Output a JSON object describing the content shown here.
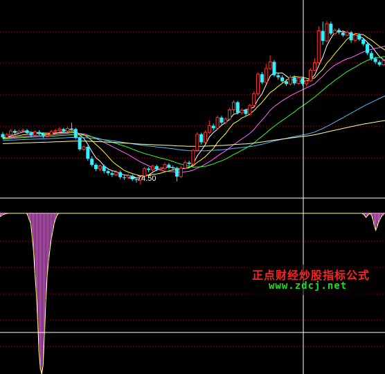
{
  "chart_data": [
    {
      "type": "candlestick",
      "panel": "price",
      "annotation_low": "74.50",
      "candles": [
        [
          98.6,
          97.0,
          99.6,
          96.2
        ],
        [
          97.0,
          98.4,
          99.1,
          96.6
        ],
        [
          98.4,
          100.1,
          101.0,
          97.8
        ],
        [
          100.1,
          99.2,
          100.9,
          98.3
        ],
        [
          99.2,
          100.0,
          100.7,
          98.6
        ],
        [
          100.0,
          100.4,
          101.3,
          99.3
        ],
        [
          100.4,
          99.1,
          101.0,
          98.4
        ],
        [
          99.1,
          98.0,
          100.0,
          97.2
        ],
        [
          98.0,
          99.6,
          100.4,
          97.4
        ],
        [
          99.6,
          98.6,
          100.5,
          98.0
        ],
        [
          98.6,
          97.7,
          99.4,
          96.8
        ],
        [
          97.7,
          98.2,
          99.1,
          97.0
        ],
        [
          98.2,
          99.8,
          100.6,
          97.6
        ],
        [
          99.8,
          100.2,
          101.2,
          99.0
        ],
        [
          100.2,
          101.0,
          102.0,
          99.5
        ],
        [
          101.0,
          100.1,
          101.6,
          99.1
        ],
        [
          100.1,
          101.3,
          102.2,
          99.6
        ],
        [
          101.3,
          101.0,
          104.0,
          100.2
        ],
        [
          101.0,
          96.8,
          101.6,
          96.0
        ],
        [
          96.8,
          91.3,
          97.5,
          90.6
        ],
        [
          91.3,
          92.5,
          93.3,
          90.4
        ],
        [
          92.5,
          86.8,
          93.0,
          85.8
        ],
        [
          86.8,
          83.9,
          88.0,
          83.1
        ],
        [
          83.9,
          81.9,
          84.6,
          81.0
        ],
        [
          81.9,
          83.4,
          84.0,
          80.9
        ],
        [
          83.4,
          80.9,
          84.1,
          79.8
        ],
        [
          80.9,
          79.9,
          81.7,
          78.8
        ],
        [
          79.9,
          79.1,
          80.8,
          78.1
        ],
        [
          79.1,
          80.4,
          81.2,
          78.5
        ],
        [
          80.4,
          78.0,
          81.1,
          77.0
        ],
        [
          78.0,
          77.9,
          78.8,
          76.8
        ],
        [
          77.9,
          78.7,
          79.6,
          77.1
        ],
        [
          78.7,
          77.0,
          79.3,
          76.1
        ],
        [
          77.0,
          76.6,
          77.8,
          75.4
        ],
        [
          76.6,
          78.3,
          78.9,
          74.5
        ],
        [
          78.3,
          82.1,
          82.9,
          77.6
        ],
        [
          82.1,
          81.5,
          82.8,
          80.4
        ],
        [
          81.5,
          83.3,
          84.0,
          80.7
        ],
        [
          83.3,
          81.8,
          84.0,
          80.9
        ],
        [
          81.8,
          82.2,
          83.0,
          81.1
        ],
        [
          82.2,
          84.0,
          85.1,
          81.6
        ],
        [
          84.0,
          82.7,
          84.8,
          81.8
        ],
        [
          82.7,
          82.4,
          83.6,
          81.3
        ],
        [
          82.4,
          78.3,
          83.0,
          76.0
        ],
        [
          78.3,
          82.3,
          83.5,
          77.6
        ],
        [
          82.3,
          85.0,
          86.1,
          81.7
        ],
        [
          85.0,
          84.3,
          85.9,
          83.2
        ],
        [
          84.3,
          90.8,
          91.5,
          83.6
        ],
        [
          90.8,
          98.5,
          99.5,
          90.1
        ],
        [
          98.5,
          94.7,
          99.3,
          93.6
        ],
        [
          94.7,
          99.4,
          100.3,
          93.8
        ],
        [
          99.4,
          102.6,
          105.1,
          98.8
        ],
        [
          102.6,
          101.4,
          103.6,
          100.3
        ],
        [
          101.4,
          106.5,
          107.5,
          100.9
        ],
        [
          106.5,
          104.1,
          107.3,
          103.2
        ],
        [
          104.1,
          105.8,
          106.6,
          103.2
        ],
        [
          105.8,
          110.2,
          111.2,
          105.0
        ],
        [
          110.2,
          113.8,
          114.8,
          108.1
        ],
        [
          113.8,
          108.8,
          114.4,
          107.9
        ],
        [
          108.8,
          110.0,
          110.9,
          107.8
        ],
        [
          110.0,
          108.2,
          110.8,
          107.2
        ],
        [
          108.2,
          112.3,
          113.1,
          107.4
        ],
        [
          112.3,
          117.9,
          119.0,
          111.6
        ],
        [
          117.9,
          127.2,
          128.0,
          116.9
        ],
        [
          127.2,
          123.3,
          128.2,
          122.5
        ],
        [
          123.3,
          129.9,
          132.1,
          122.5
        ],
        [
          129.9,
          133.1,
          136.2,
          129.2
        ],
        [
          133.1,
          126.7,
          134.0,
          126.0
        ],
        [
          126.7,
          125.7,
          127.6,
          124.6
        ],
        [
          125.7,
          123.8,
          126.7,
          122.9
        ],
        [
          123.8,
          122.5,
          124.8,
          121.6
        ],
        [
          122.5,
          125.7,
          126.8,
          121.8
        ],
        [
          125.7,
          122.8,
          126.7,
          121.9
        ],
        [
          122.8,
          125.3,
          126.2,
          122.1
        ],
        [
          125.3,
          122.6,
          125.9,
          121.7
        ],
        [
          122.6,
          124.0,
          124.6,
          121.4
        ],
        [
          124.0,
          129.1,
          130.1,
          123.6
        ],
        [
          129.1,
          132.7,
          134.8,
          128.6
        ],
        [
          132.7,
          147.9,
          150.0,
          132.2
        ],
        [
          147.9,
          143.1,
          152.3,
          141.2
        ],
        [
          143.1,
          151.3,
          152.6,
          142.5
        ],
        [
          151.3,
          146.6,
          152.4,
          145.8
        ],
        [
          146.6,
          148.3,
          149.1,
          145.9
        ],
        [
          148.3,
          147.2,
          149.2,
          146.2
        ],
        [
          147.2,
          145.8,
          147.9,
          145.0
        ],
        [
          145.8,
          147.2,
          148.0,
          145.3
        ],
        [
          147.2,
          143.4,
          147.9,
          142.2
        ],
        [
          143.4,
          145.9,
          146.9,
          142.4
        ],
        [
          145.9,
          143.8,
          146.9,
          143.1
        ],
        [
          143.8,
          141.6,
          144.5,
          140.7
        ],
        [
          141.6,
          137.3,
          142.2,
          136.4
        ],
        [
          137.3,
          134.7,
          138.3,
          133.7
        ],
        [
          134.7,
          133.0,
          135.5,
          132.0
        ],
        [
          133.0,
          131.7,
          133.8,
          130.9
        ],
        [
          131.7,
          133.7,
          134.6,
          131.1
        ],
        [
          133.7,
          134.0,
          136.2,
          133.1
        ]
      ],
      "moving_averages": [
        {
          "period": 5,
          "color": "#ffffff"
        },
        {
          "period": 10,
          "color": "#ffff33"
        },
        {
          "period": 20,
          "color": "#ff66ff"
        },
        {
          "period": 30,
          "color": "#33ff33"
        },
        {
          "period": 60,
          "color": "#55bbff"
        },
        {
          "period": 120,
          "color": "#ffffaa"
        }
      ],
      "colors": {
        "up": "#ff3333",
        "down": "#33eeff",
        "axis": "#ffffff",
        "grid": "#bb0000"
      }
    },
    {
      "type": "histogram",
      "panel": "indicator",
      "values": [
        -5.1,
        -2.9,
        -1.8,
        -1.2,
        -0.6,
        -0.2,
        0.0,
        0.0,
        0.0,
        0.0,
        0.0,
        0.0,
        0.0,
        0.0,
        0.0,
        0.0,
        0.0,
        0.0,
        0.0,
        0.0,
        -3.7,
        -9.9,
        -14.6,
        -33.3,
        -54.6,
        -87.6,
        -115.7,
        -156.1,
        -204.4,
        -229.2,
        -236.7,
        -223.8,
        -177.7,
        -126.3,
        -90.5,
        -69.4,
        -52.4,
        -37.1,
        -26.1,
        -15.4,
        -8.5,
        -3.4,
        -0.4,
        0.0,
        0.0,
        0.0,
        0.0,
        0.0,
        0.0,
        0.0,
        0.0,
        0.0,
        0.0,
        0.0,
        0.0,
        0.0,
        0.0,
        0.0,
        0.0,
        0.0,
        0.0,
        0.0,
        0.0,
        0.0,
        0.0,
        0.0,
        0.0,
        0.0,
        0.0,
        0.0,
        0.0,
        0.0,
        0.0,
        0.0,
        0.0,
        0.0,
        0.0,
        0.0,
        0.0,
        0.0,
        0.0,
        0.0,
        0.0,
        0.0,
        0.0,
        0.0,
        0.0,
        0.0,
        0.0,
        0.0,
        0.0,
        0.0,
        0.0,
        0.0,
        0.0,
        0.0,
        0.0,
        0.0,
        0.0,
        0.0,
        0.0,
        0.0,
        0.0,
        0.0,
        0.0,
        0.0,
        0.0,
        0.0,
        0.0,
        0.0,
        0.0,
        0.0,
        0.0,
        0.0,
        0.0,
        0.0,
        0.0,
        0.0,
        0.0,
        0.0,
        0.0,
        0.0,
        0.0,
        0.0,
        0.0,
        0.0,
        0.0,
        0.0,
        0.0,
        0.0,
        0.0,
        0.0,
        0.0,
        0.0,
        0.0,
        0.0,
        0.0,
        0.0,
        0.0,
        0.0,
        0.0,
        0.0,
        0.0,
        0.0,
        0.0,
        0.0,
        0.0,
        0.0,
        0.0,
        0.0,
        0.0,
        0.0,
        0.0,
        0.0,
        0.0,
        0.0,
        0.0,
        0.0,
        0.0,
        0.0,
        0.0,
        0.0,
        0.0,
        0.0,
        0.0,
        0.0,
        0.0,
        0.0,
        0.0,
        0.0,
        0.0,
        0.0,
        0.0,
        0.0,
        0.0,
        0.0,
        0.0,
        0.0,
        0.0,
        0.0,
        0.0,
        0.0,
        0.0,
        0.0,
        0.0,
        0.0,
        0.0,
        0.0,
        0.0,
        0.0,
        0.0,
        0.0,
        0.0,
        0.0,
        0.0,
        0.0,
        0.0,
        0.0,
        0.0,
        0.0,
        0.0,
        0.0,
        0.0,
        0.0,
        0.0,
        0.0,
        0.0,
        0.0,
        0.0,
        0.0,
        0.0,
        0.0,
        0.0,
        0.0,
        0.0,
        0.0,
        0.0,
        0.0,
        0.0,
        0.0,
        0.0,
        0.0,
        0.0,
        0.0,
        0.0,
        0.0,
        0.0,
        0.0,
        0.0,
        0.0,
        0.0,
        0.0,
        0.0,
        0.0,
        0.0,
        0.0,
        0.0,
        0.0,
        0.0,
        0.0,
        0.0,
        0.0,
        0.0,
        0.0,
        0.0,
        0.0,
        0.0,
        0.0,
        0.0,
        0.0,
        0.0,
        0.0,
        0.0,
        0.0,
        0.0,
        0.0,
        0.0,
        0.0,
        0.0,
        0.0,
        0.0,
        0.0,
        0.0,
        -1.3,
        -3.4,
        -6.1,
        -3.6,
        -1.5,
        -0.2,
        -3.3,
        -9.2,
        -18.7,
        -25.1,
        -19.8,
        -14.1,
        -9.2,
        -5.4,
        -2.8,
        -1.2
      ],
      "colors": {
        "bar": "#ff99ff",
        "edge": "#ffff66",
        "baseline": "#ffff66",
        "grid": "#bb0000"
      }
    }
  ],
  "watermark": {
    "cn": "正点财经炒股指标公式",
    "url": "www.zdcj.net"
  }
}
